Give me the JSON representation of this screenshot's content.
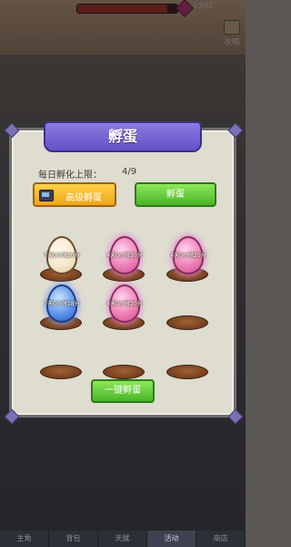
{
  "hud": {
    "hp_fill_fraction": 0.9,
    "hp_color": "#b22a25",
    "value_text": "1582",
    "gem_icon": "gem-icon",
    "guide_label": "攻略"
  },
  "dialog": {
    "title": "孵蛋",
    "daily_limit_label": "每日孵化上限：",
    "daily_limit_value": "4/9",
    "advanced_hatch_label": "高级孵蛋",
    "hatch_label": "孵蛋",
    "hatch_all_label": "一键孵蛋"
  },
  "slots": [
    {
      "egg": "white",
      "time": "7天0小时20分"
    },
    {
      "egg": "pink",
      "time": "4天0小时20分"
    },
    {
      "egg": "pink",
      "time": "4天0小时20分"
    },
    {
      "egg": "blue",
      "time": "7天0小时18分"
    },
    {
      "egg": "pink",
      "time": "4天0小时20分"
    },
    {
      "egg": null,
      "time": ""
    },
    {
      "egg": null,
      "time": ""
    },
    {
      "egg": null,
      "time": ""
    },
    {
      "egg": null,
      "time": ""
    }
  ],
  "bottom_nav": [
    "主角",
    "背包",
    "天赋",
    "活动",
    "商店"
  ],
  "colors": {
    "ribbon": "#6f5ed6",
    "green_button": "#5cc83a",
    "yellow_button": "#f4b427"
  }
}
